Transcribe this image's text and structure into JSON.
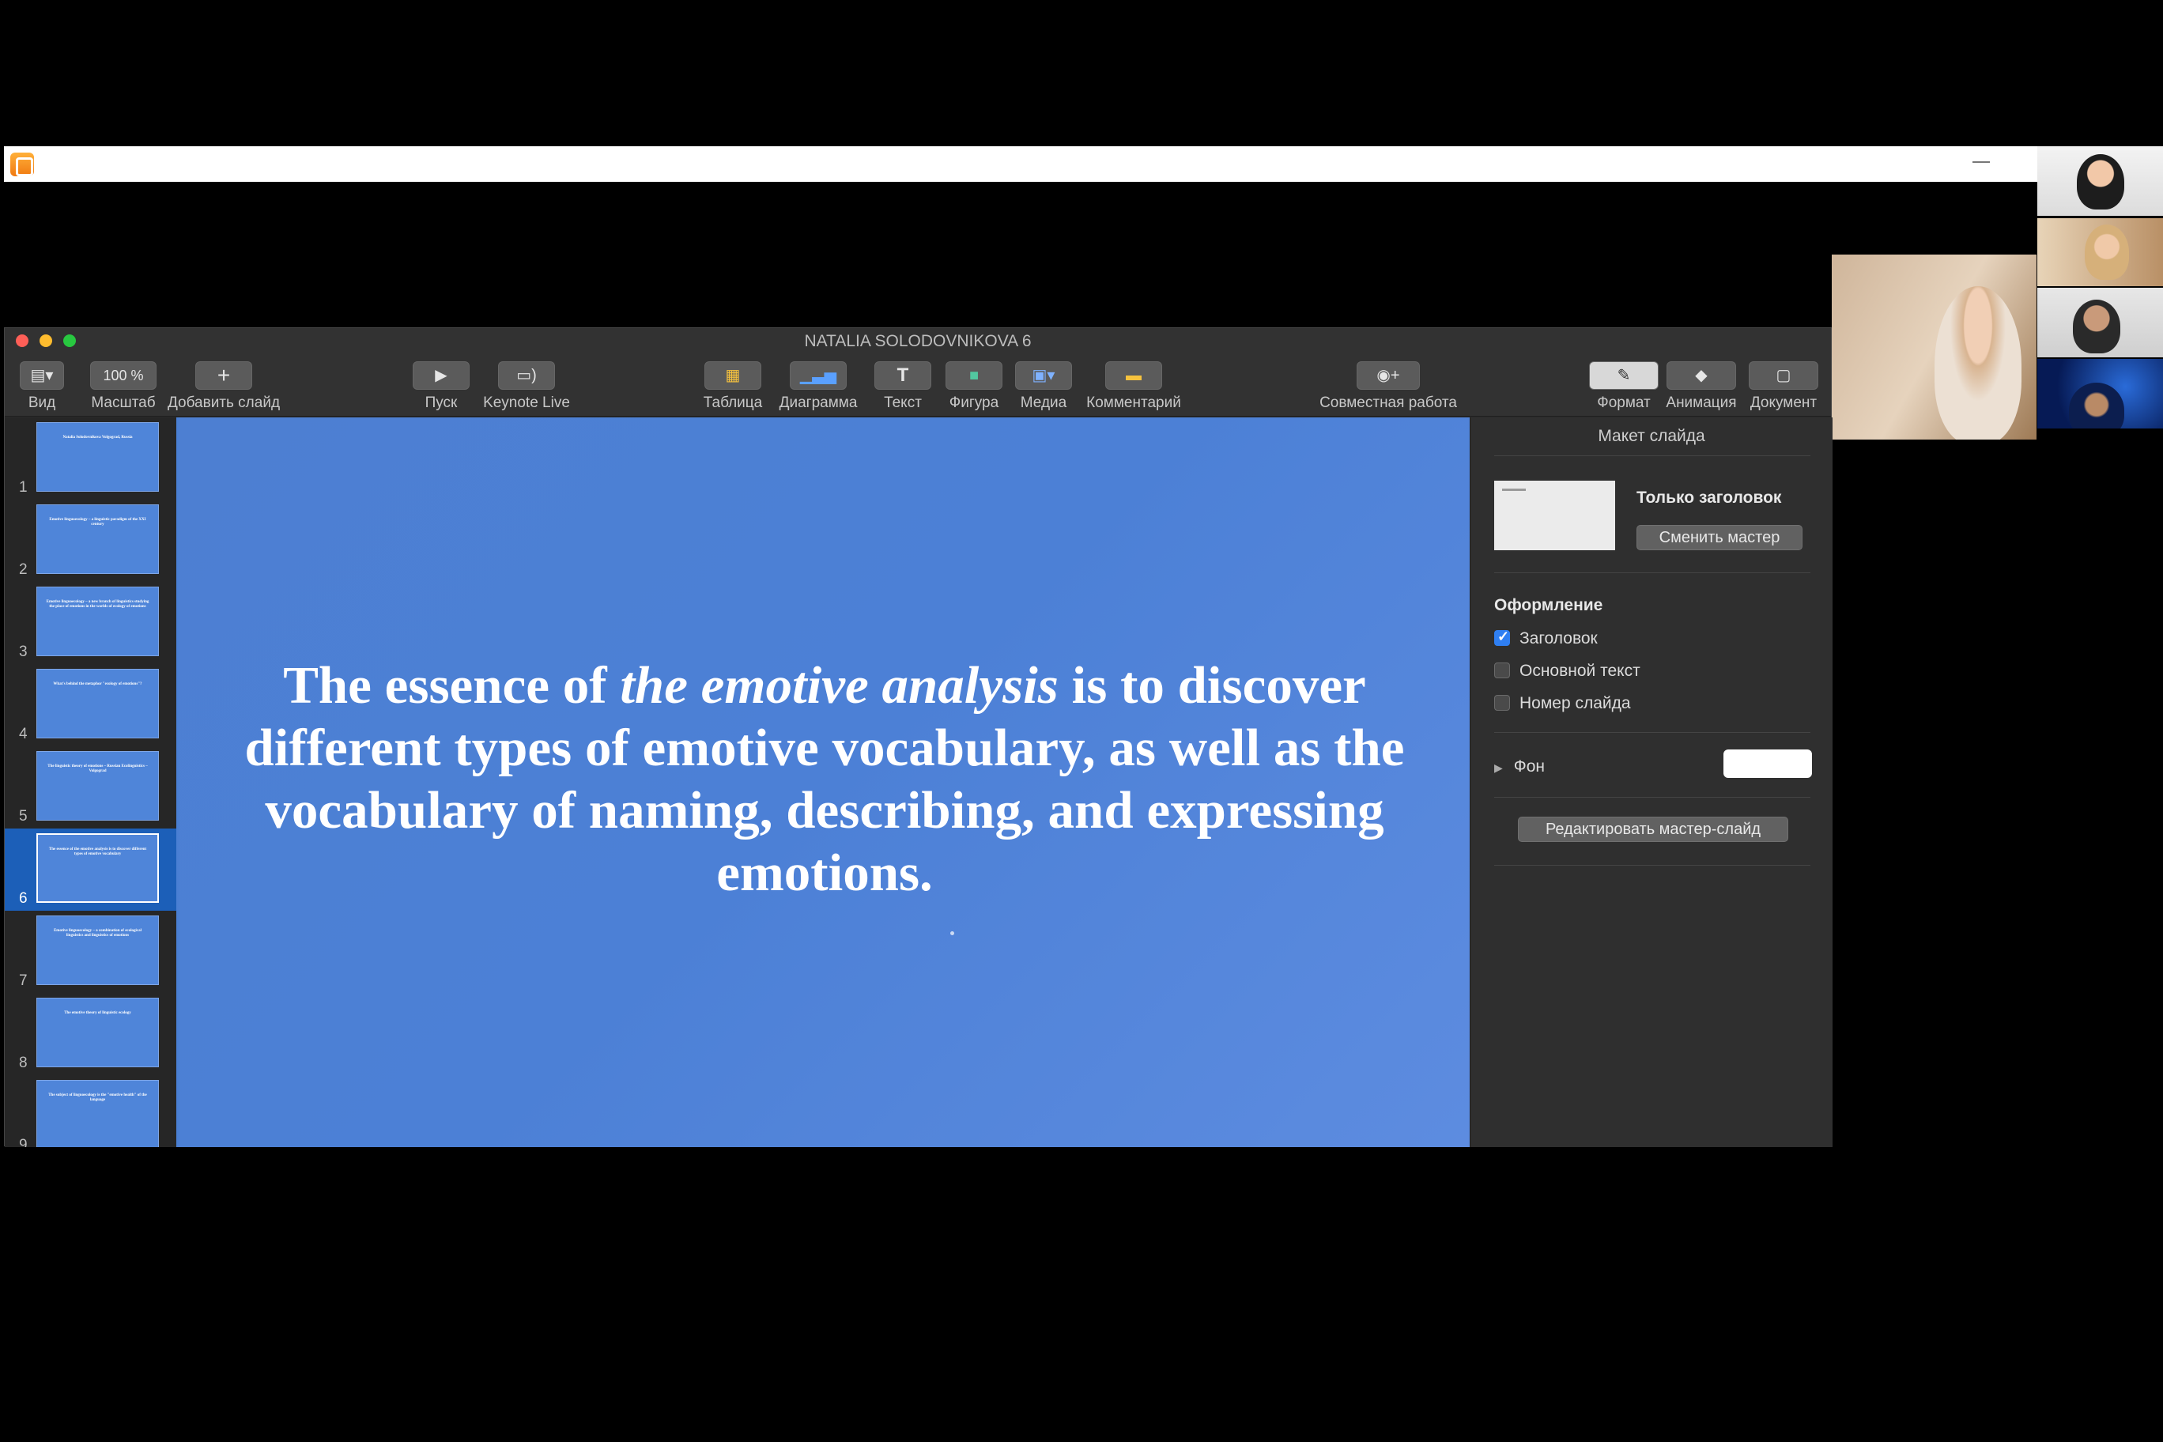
{
  "window": {
    "title": "NATALIA SOLODOVNIKOVA 6"
  },
  "toolbar": {
    "view": "Вид",
    "zoom_value": "100 %",
    "zoom": "Масштаб",
    "add_slide": "Добавить слайд",
    "play": "Пуск",
    "keynote_live": "Keynote Live",
    "table": "Таблица",
    "chart": "Диаграмма",
    "text": "Текст",
    "shape": "Фигура",
    "media": "Медиа",
    "comment": "Комментарий",
    "collaborate": "Совместная работа",
    "format": "Формат",
    "animate": "Анимация",
    "document": "Документ"
  },
  "slides": [
    {
      "num": "1",
      "text": "Natalia Solodovnikova Volgograd, Russia"
    },
    {
      "num": "2",
      "text": "Emotive linguoecology – a linguistic paradigm of the XXI century"
    },
    {
      "num": "3",
      "text": "Emotive linguoecology – a new branch of linguistics studying the place of emotions in the worlds of ecology of emotions"
    },
    {
      "num": "4",
      "text": "What's behind the metaphor \"ecology of emotions\"?"
    },
    {
      "num": "5",
      "text": "The linguistic theory of emotions – Russian Ecolinguistics – Volgograd"
    },
    {
      "num": "6",
      "text": "The essence of the emotive analysis is to discover different types of emotive vocabulary"
    },
    {
      "num": "7",
      "text": "Emotive linguoecology – a combination of ecological linguistics and linguistics of emotions"
    },
    {
      "num": "8",
      "text": "The emotive theory of linguistic ecology"
    },
    {
      "num": "9",
      "text": "The subject of linguoecology is the \"emotive health\" of the language"
    }
  ],
  "slide": {
    "part1": "The essence of ",
    "italic": "the emotive analysis",
    "part2": " is to discover different types of emotive vocabulary, as well as the vocabulary of naming, describing, and expressing emotions."
  },
  "inspector": {
    "title": "Макет слайда",
    "layout_name": "Только заголовок",
    "change_master": "Сменить мастер",
    "appearance": "Оформление",
    "title_chk": "Заголовок",
    "body_chk": "Основной текст",
    "slide_num_chk": "Номер слайда",
    "background": "Фон",
    "background_color": "#ffffff",
    "edit_master": "Редактировать мастер-слайд"
  }
}
